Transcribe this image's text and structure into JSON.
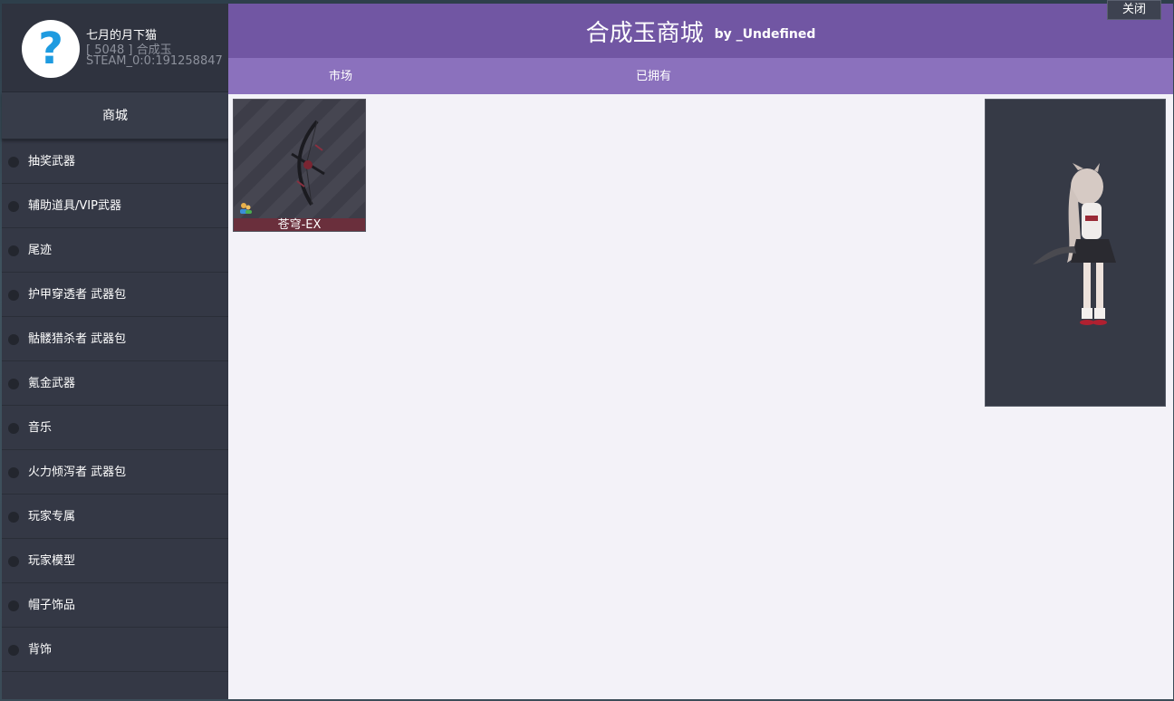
{
  "profile": {
    "avatar_glyph": "?",
    "name": "七月的月下猫",
    "currency": "[ 5048 ] 合成玉",
    "steam_id": "STEAM_0:0:191258847"
  },
  "sidebar": {
    "shop_label": "商城",
    "categories": [
      {
        "label": "抽奖武器"
      },
      {
        "label": "辅助道具/VIP武器"
      },
      {
        "label": "尾迹"
      },
      {
        "label": "护甲穿透者 武器包"
      },
      {
        "label": "骷髅猎杀者 武器包"
      },
      {
        "label": "氪金武器"
      },
      {
        "label": "音乐"
      },
      {
        "label": "火力倾泻者 武器包"
      },
      {
        "label": "玩家专属"
      },
      {
        "label": "玩家模型"
      },
      {
        "label": "帽子饰品"
      },
      {
        "label": "背饰"
      }
    ]
  },
  "header": {
    "title": "合成玉商城",
    "byline": "by _Undefined",
    "close_label": "关闭"
  },
  "tabs": [
    {
      "label": "市场"
    },
    {
      "label": "已拥有"
    }
  ],
  "items": [
    {
      "name": "苍穹-EX",
      "icon": "bow-weapon-icon",
      "badge": "player-badge-icon"
    }
  ],
  "preview": {
    "icon": "character-model-icon"
  },
  "colors": {
    "title_bar": "#7156a3",
    "tab_bar": "#8b71bd",
    "sidebar": "#343845",
    "content_bg": "#f3f2f8",
    "item_name_bg": "#6a2f3c"
  }
}
